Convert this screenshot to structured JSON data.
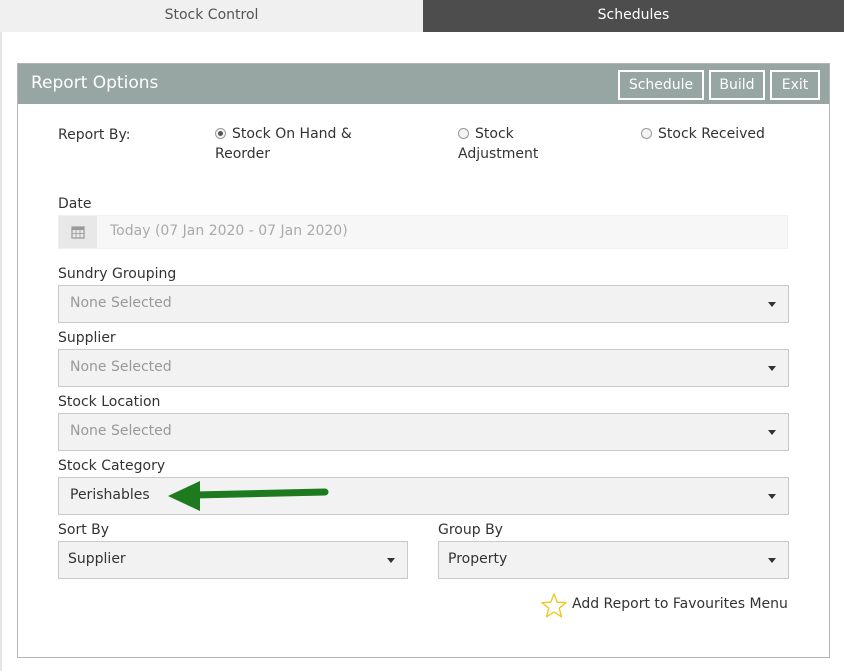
{
  "tabs": [
    {
      "label": "Stock Control",
      "active": true
    },
    {
      "label": "Schedules",
      "active": false
    }
  ],
  "panel": {
    "title": "Report Options",
    "buttons": {
      "schedule": "Schedule",
      "build": "Build",
      "exit": "Exit"
    }
  },
  "report_by": {
    "label": "Report By:",
    "options": [
      {
        "line1": "Stock On Hand &",
        "line2": "Reorder",
        "checked": true
      },
      {
        "line1": "Stock",
        "line2": "Adjustment",
        "checked": false
      },
      {
        "line1": "Stock Received",
        "line2": "",
        "checked": false
      }
    ]
  },
  "date": {
    "label": "Date",
    "value": "Today (07 Jan 2020 - 07 Jan 2020)",
    "icon": "calendar-icon"
  },
  "sundry_grouping": {
    "label": "Sundry Grouping",
    "value": "None Selected"
  },
  "supplier": {
    "label": "Supplier",
    "value": "None Selected"
  },
  "stock_location": {
    "label": "Stock Location",
    "value": "None Selected"
  },
  "stock_category": {
    "label": "Stock Category",
    "value": "Perishables"
  },
  "sort_by": {
    "label": "Sort By",
    "value": "Supplier"
  },
  "group_by": {
    "label": "Group By",
    "value": "Property"
  },
  "favourites": {
    "label": "Add Report to Favourites Menu",
    "icon": "star-icon"
  },
  "colors": {
    "header": "#97a6a2",
    "arrow": "#1e7a1e",
    "star": "#f0c419",
    "inactive_tab": "#4d4d4d"
  }
}
